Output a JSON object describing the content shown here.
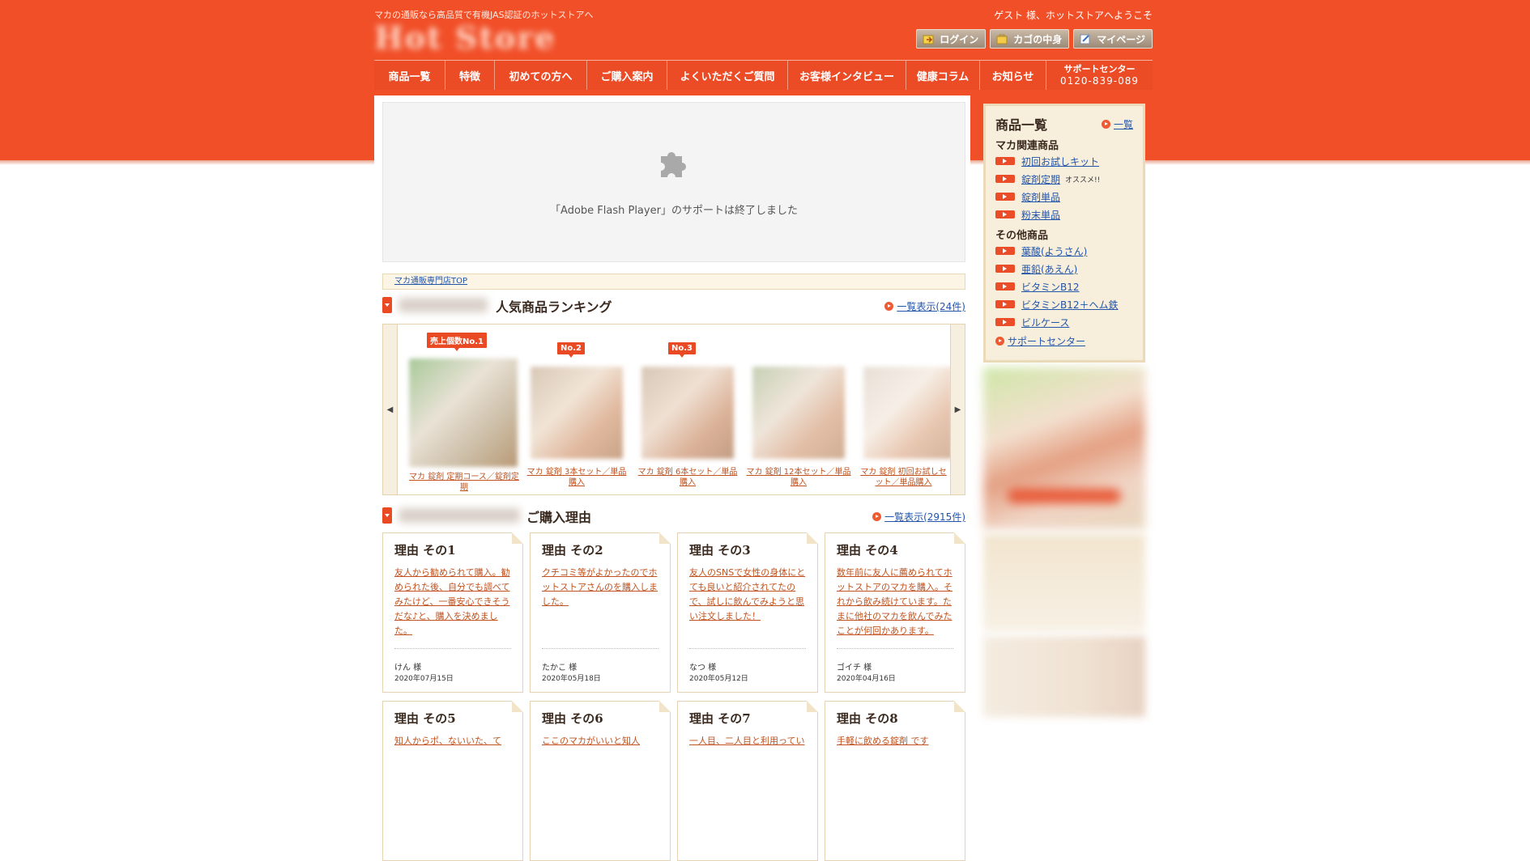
{
  "header": {
    "tagline": "マカの通販なら高品質で有機JAS認証のホットストアへ",
    "welcome": "ゲスト 様、ホットストアへようこそ",
    "logo_text": "Hot Store",
    "buttons": [
      {
        "label": "ログイン",
        "icon": "login-icon"
      },
      {
        "label": "カゴの中身",
        "icon": "cart-icon"
      },
      {
        "label": "マイページ",
        "icon": "mypage-icon"
      }
    ]
  },
  "nav": {
    "items": [
      "商品一覧",
      "特徴",
      "初めての方へ",
      "ご購入案内",
      "よくいただくご質問",
      "お客様インタビュー",
      "健康コラム",
      "お知らせ"
    ],
    "support_label": "サポートセンター",
    "support_tel": "0120-839-089"
  },
  "flash": {
    "message": "「Adobe Flash Player」のサポートは終了しました"
  },
  "breadcrumb": {
    "label": "マカ通販専門店TOP"
  },
  "ranking": {
    "title": "人気商品ランキング",
    "more": "一覧表示(24件)",
    "products": [
      {
        "badge": "売上個数No.1",
        "caption": "マカ 錠剤 定期コース／錠剤定期"
      },
      {
        "badge": "No.2",
        "caption": "マカ 錠剤 3本セット／単品購入"
      },
      {
        "badge": "No.3",
        "caption": "マカ 錠剤 6本セット／単品購入"
      },
      {
        "badge": "",
        "caption": "マカ 錠剤 12本セット／単品購入"
      },
      {
        "badge": "",
        "caption": "マカ 錠剤 初回お試しセット／単品購入"
      }
    ]
  },
  "reasons": {
    "title": "ご購入理由",
    "more": "一覧表示(2915件)",
    "cards": [
      {
        "title": "理由 その1",
        "text": "友人から勧められて購入。勧められた後、自分でも調べてみたけど、一番安心できそうだな♪と、購入を決めました。",
        "name": "けん 様",
        "date": "2020年07月15日"
      },
      {
        "title": "理由 その2",
        "text": "クチコミ等がよかったのでホットストアさんのを購入しました。",
        "name": "たかこ 様",
        "date": "2020年05月18日"
      },
      {
        "title": "理由 その3",
        "text": "友人のSNSで女性の身体にとても良いと紹介されてたので、試しに飲んでみようと思い注文しました！",
        "name": "なつ 様",
        "date": "2020年05月12日"
      },
      {
        "title": "理由 その4",
        "text": "数年前に友人に薦められてホットストアのマカを購入。それから飲み続けています。たまに他社のマカを飲んでみたことが何回かあります。",
        "name": "ゴイチ 様",
        "date": "2020年04月16日"
      },
      {
        "title": "理由 その5",
        "text": "知人からポ、ないいた、て",
        "name": "",
        "date": ""
      },
      {
        "title": "理由 その6",
        "text": "ここのマカがいいと知人",
        "name": "",
        "date": ""
      },
      {
        "title": "理由 その7",
        "text": "一人目、二人目と利用ってい",
        "name": "",
        "date": ""
      },
      {
        "title": "理由 その8",
        "text": "手軽に飲める錠剤 です",
        "name": "",
        "date": ""
      }
    ]
  },
  "sidebar": {
    "heading": "商品一覧",
    "all_link": "一覧",
    "cat1": "マカ関連商品",
    "cat1_items": [
      "初回お試しキット",
      "錠剤定期",
      "錠剤単品",
      "粉末単品"
    ],
    "recommend": "オススメ!!",
    "cat2": "その他商品",
    "cat2_items": [
      "葉酸(ようさん)",
      "亜鉛(あえん)",
      "ビタミンB12",
      "ビタミンB12＋ヘム鉄",
      "ビルケース"
    ],
    "support_link": "サポートセンター"
  },
  "colors": {
    "brand": "#f14f28",
    "link": "#2255aa",
    "accent_text": "#c0531f"
  }
}
